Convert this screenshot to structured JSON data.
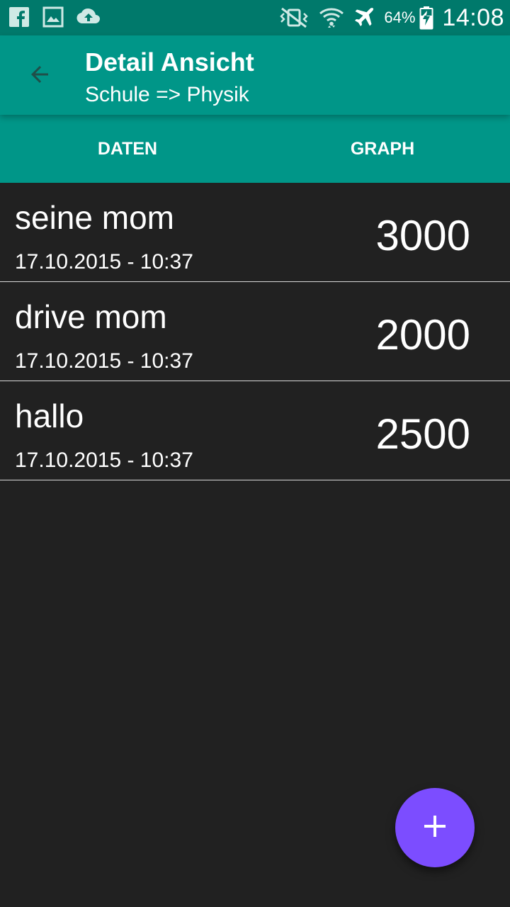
{
  "status_bar": {
    "left_icons": [
      "facebook-icon",
      "gallery-icon",
      "cloud-upload-icon"
    ],
    "right_icons": [
      "vibrate-icon",
      "wifi-icon",
      "airplane-icon"
    ],
    "battery_percent": "64%",
    "time": "14:08"
  },
  "app_bar": {
    "title": "Detail Ansicht",
    "subtitle": "Schule => Physik",
    "background_color": "#009688"
  },
  "tabs": [
    {
      "label": "DATEN"
    },
    {
      "label": "GRAPH"
    }
  ],
  "entries": [
    {
      "name": "seine mom",
      "timestamp": "17.10.2015 - 10:37",
      "value": "3000"
    },
    {
      "name": "drive mom",
      "timestamp": "17.10.2015 - 10:37",
      "value": "2000"
    },
    {
      "name": "hallo",
      "timestamp": "17.10.2015 - 10:37",
      "value": "2500"
    }
  ],
  "fab": {
    "icon": "plus-icon",
    "color": "#7c4dff"
  }
}
